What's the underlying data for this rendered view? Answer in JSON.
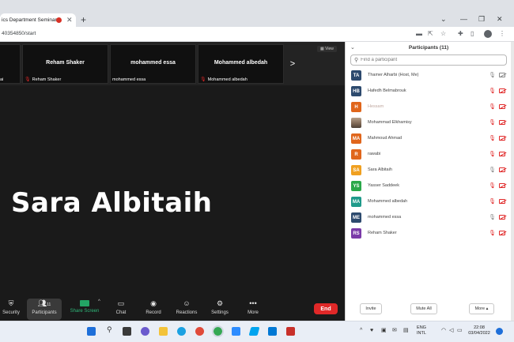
{
  "browser": {
    "tab_title": "ics Department Seminar",
    "url": "40354850/start"
  },
  "meeting": {
    "thumbnails": [
      {
        "name": "",
        "label": "ai"
      },
      {
        "name": "Reham Shaker",
        "label": "Reham Shaker",
        "muted": true
      },
      {
        "name": "mohammed essa",
        "label": "mohammed essa",
        "muted": false
      },
      {
        "name": "Mohammed albedah",
        "label": "Mohammed albedah",
        "muted": true
      }
    ],
    "view_label": "View",
    "next_arrow": ">",
    "active_speaker": "Sara Albitaih"
  },
  "toolbar": {
    "security": "Security",
    "participants": "Participants",
    "participants_count": "11",
    "share_screen": "Share Screen",
    "chat": "Chat",
    "record": "Record",
    "reactions": "Reactions",
    "settings": "Settings",
    "more": "More",
    "end": "End"
  },
  "panel": {
    "title": "Participants (11)",
    "search_placeholder": "Find a participant",
    "participants": [
      {
        "initials": "TA",
        "name": "Thamer Alharbi (Host, Me)",
        "color": "#2d4a6e",
        "mic": "on",
        "cam": "on"
      },
      {
        "initials": "HB",
        "name": "Hafedh Belmabrouk",
        "color": "#2d4a6e",
        "mic": "muted",
        "cam": "off"
      },
      {
        "initials": "H",
        "name": "Hessam",
        "color": "#e0661c",
        "mic": "muted",
        "cam": "off"
      },
      {
        "initials": "",
        "name": "Mohammad Elkhamisy",
        "color": "#8a7360",
        "mic": "muted",
        "cam": "off",
        "photo": true
      },
      {
        "initials": "MA",
        "name": "Mahmoud Ahmad",
        "color": "#e0661c",
        "mic": "muted",
        "cam": "off"
      },
      {
        "initials": "R",
        "name": "rawabi",
        "color": "#e0661c",
        "mic": "muted",
        "cam": "off"
      },
      {
        "initials": "SA",
        "name": "Sara Albitaih",
        "color": "#f0a020",
        "mic": "on",
        "cam": "off"
      },
      {
        "initials": "YS",
        "name": "Yasser Saddeek",
        "color": "#2aa84a",
        "mic": "muted",
        "cam": "off"
      },
      {
        "initials": "MA",
        "name": "Mohammed albedah",
        "color": "#1f9a8a",
        "mic": "muted",
        "cam": "off"
      },
      {
        "initials": "ME",
        "name": "mohammed essa",
        "color": "#2d4a6e",
        "mic": "on",
        "cam": "off"
      },
      {
        "initials": "RS",
        "name": "Reham Shaker",
        "color": "#7a3aa8",
        "mic": "muted",
        "cam": "off"
      }
    ],
    "invite": "Invite",
    "mute_all": "Mute All",
    "more": "More ▴"
  },
  "taskbar": {
    "lang_top": "ENG",
    "lang_bottom": "INTL",
    "time": "22:08",
    "date": "03/04/2022"
  }
}
